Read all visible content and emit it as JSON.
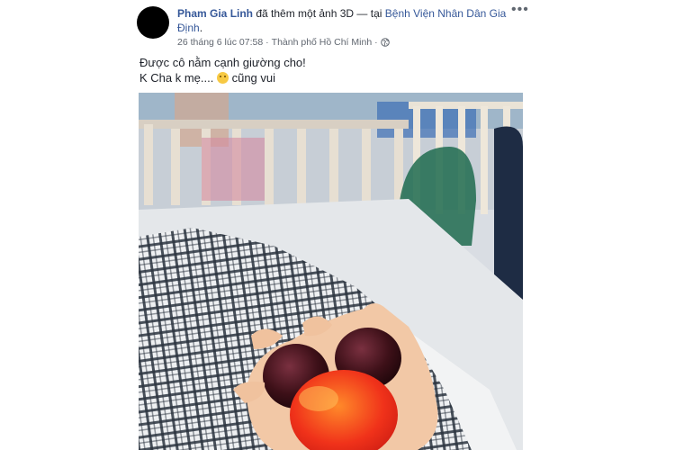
{
  "post": {
    "author": "Pham Gia Linh",
    "action_text": " đã thêm một ảnh 3D — tại ",
    "location": "Bệnh Viện Nhân Dân Gia Định",
    "location_suffix": ".",
    "timestamp": "26 tháng 6 lúc 07:58",
    "separator": " · ",
    "city": "Thành phố Hồ Chí Minh",
    "separator2": " · ",
    "privacy_icon": "globe-icon",
    "more_label": "•••",
    "caption_line1": "Được cô nằm cạnh giường cho!",
    "caption_line2": "K Cha k mẹ.... ",
    "caption_emoji": "slightly-smiling-face-emoji",
    "caption_line2_end": " cũng vui"
  },
  "colors": {
    "link": "#365899",
    "meta_text": "#616770",
    "text": "#1d2129"
  }
}
